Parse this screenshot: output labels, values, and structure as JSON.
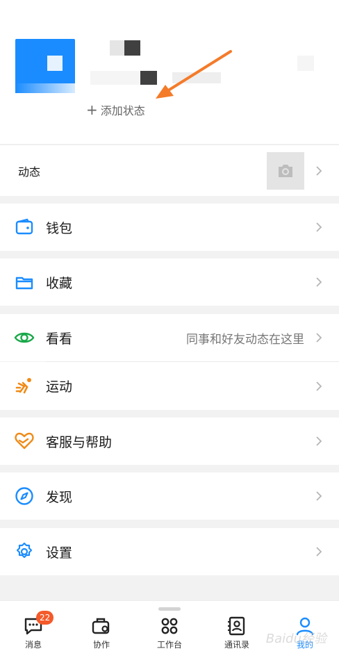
{
  "profile": {
    "add_status": "添加状态"
  },
  "feed": {
    "label": "动态"
  },
  "menu": {
    "wallet": "钱包",
    "favorites": "收藏",
    "watch": "看看",
    "watch_hint": "同事和好友动态在这里",
    "sports": "运动",
    "support": "客服与帮助",
    "discover": "发现",
    "settings": "设置"
  },
  "tabbar": {
    "messages": "消息",
    "messages_badge": "22",
    "collab": "协作",
    "workspace": "工作台",
    "contacts": "通讯录",
    "mine": "我的"
  },
  "watermark": "Baidu经验",
  "colors": {
    "accent": "#1a8cff",
    "arrow": "#f47b2a",
    "badge": "#f45a2a",
    "watch_icon": "#1aa84a",
    "sports_icon": "#f08a16",
    "support_icon": "#f08a16"
  }
}
